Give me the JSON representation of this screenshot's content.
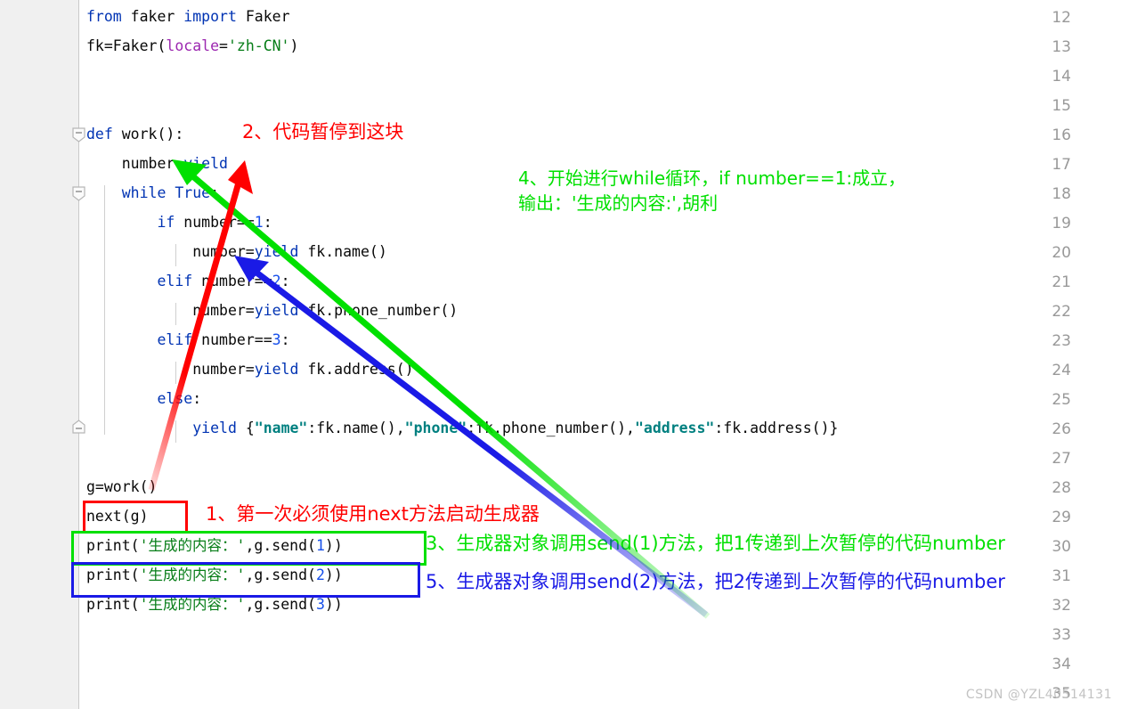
{
  "editor": {
    "line_numbers": [
      12,
      13,
      14,
      15,
      16,
      17,
      18,
      19,
      20,
      21,
      22,
      23,
      24,
      25,
      26,
      27,
      28,
      29,
      30,
      31,
      32,
      33,
      34,
      35
    ],
    "first_line": 12,
    "last_line": 35,
    "watermark": "CSDN @YZL40514131",
    "colors": {
      "gutter_bg": "#f0f0f0",
      "gutter_text": "#999999",
      "code_bg": "#ffffff",
      "keyword": "#0033b3",
      "number": "#1750eb",
      "string": "#067d17",
      "dict_key": "#008080",
      "named_arg": "#9c27b0",
      "annotation_red": "#ff0000",
      "annotation_green": "#00e000",
      "annotation_blue": "#1a1ae6"
    },
    "code_lines": [
      {
        "n": 12,
        "text": "from faker import Faker"
      },
      {
        "n": 13,
        "text": "fk=Faker(locale='zh-CN')"
      },
      {
        "n": 14,
        "text": ""
      },
      {
        "n": 15,
        "text": ""
      },
      {
        "n": 16,
        "text": "def work():"
      },
      {
        "n": 17,
        "text": "    number=yield"
      },
      {
        "n": 18,
        "text": "    while True:"
      },
      {
        "n": 19,
        "text": "        if number==1:"
      },
      {
        "n": 20,
        "text": "            number=yield fk.name()"
      },
      {
        "n": 21,
        "text": "        elif number==2:"
      },
      {
        "n": 22,
        "text": "            number=yield fk.phone_number()"
      },
      {
        "n": 23,
        "text": "        elif number==3:"
      },
      {
        "n": 24,
        "text": "            number=yield fk.address()"
      },
      {
        "n": 25,
        "text": "        else:"
      },
      {
        "n": 26,
        "text": "            yield {\"name\":fk.name(),\"phone\":fk.phone_number(),\"address\":fk.address()}"
      },
      {
        "n": 27,
        "text": ""
      },
      {
        "n": 28,
        "text": "g=work()"
      },
      {
        "n": 29,
        "text": "next(g)"
      },
      {
        "n": 30,
        "text": "print('生成的内容：',g.send(1))"
      },
      {
        "n": 31,
        "text": "print('生成的内容：',g.send(2))"
      },
      {
        "n": 32,
        "text": "print('生成的内容：',g.send(3))"
      },
      {
        "n": 33,
        "text": ""
      },
      {
        "n": 34,
        "text": ""
      },
      {
        "n": 35,
        "text": ""
      }
    ],
    "tokens": {
      "l12": {
        "kw1": "from",
        "mod": " faker ",
        "kw2": "import",
        "name": " Faker"
      },
      "l13": {
        "pre": "fk=Faker(",
        "arg": "locale",
        "eq": "=",
        "str": "'zh-CN'",
        "post": ")"
      },
      "l16": {
        "kw": "def",
        "rest": " work():"
      },
      "l17": {
        "pre": "    number=",
        "kw": "yield"
      },
      "l18": {
        "pre": "    ",
        "kw": "while",
        "kw2": " True",
        "post": ":"
      },
      "l19": {
        "pre": "        ",
        "kw": "if",
        "mid": " number==",
        "num": "1",
        "post": ":"
      },
      "l20": {
        "pre": "            number=",
        "kw": "yield",
        "post": " fk.name()"
      },
      "l21": {
        "pre": "        ",
        "kw": "elif",
        "mid": " number==",
        "num": "2",
        "post": ":"
      },
      "l22": {
        "pre": "            number=",
        "kw": "yield",
        "post": " fk.phone_number()"
      },
      "l23": {
        "pre": "        ",
        "kw": "elif",
        "mid": " number==",
        "num": "3",
        "post": ":"
      },
      "l24": {
        "pre": "            number=",
        "kw": "yield",
        "post": " fk.address()"
      },
      "l25": {
        "pre": "        ",
        "kw": "else",
        "post": ":"
      },
      "l26": {
        "pre": "            ",
        "kw": "yield",
        "brace1": " {",
        "k1": "\"name\"",
        "v1": ":fk.name(),",
        "k2": "\"phone\"",
        "v2": ":fk.phone_number(),",
        "k3": "\"address\"",
        "v3": ":fk.address()}"
      },
      "l28": {
        "text": "g=work()"
      },
      "l29": {
        "text": "next(g)"
      },
      "l30": {
        "pre": "print(",
        "str": "'生成的内容：'",
        "mid": ",g.send(",
        "num": "1",
        "post": "))"
      },
      "l31": {
        "pre": "print(",
        "str": "'生成的内容：'",
        "mid": ",g.send(",
        "num": "2",
        "post": "))"
      },
      "l32": {
        "pre": "print(",
        "str": "'生成的内容：'",
        "mid": ",g.send(",
        "num": "3",
        "post": "))"
      }
    }
  },
  "annotations": [
    {
      "id": "a2",
      "color": "red",
      "text": "2、代码暂停到这块"
    },
    {
      "id": "a4l1",
      "color": "green",
      "text": "4、开始进行while循环，if number==1:成立，"
    },
    {
      "id": "a4l2",
      "color": "green",
      "text": "输出：'生成的内容:',胡利"
    },
    {
      "id": "a1",
      "color": "red",
      "text": "1、第一次必须使用next方法启动生成器"
    },
    {
      "id": "a3",
      "color": "green",
      "text": "3、生成器对象调用send(1)方法，把1传递到上次暂停的代码number"
    },
    {
      "id": "a5",
      "color": "blue",
      "text": "5、生成器对象调用send(2)方法，把2传递到上次暂停的代码number"
    }
  ],
  "highlight_boxes": [
    {
      "id": "box-next",
      "color": "#ff0000",
      "target_line": 29
    },
    {
      "id": "box-send1",
      "color": "#00e000",
      "target_line": 30
    },
    {
      "id": "box-send2",
      "color": "#1a1ae6",
      "target_line": 31
    }
  ],
  "arrows": [
    {
      "id": "arrow-green",
      "color": "#00e000",
      "from": "print send(1) line",
      "to": "number=yield (line 17)"
    },
    {
      "id": "arrow-red",
      "color": "#ff0000",
      "from": "next(g) (line 29)",
      "to": "number=yield (line 17)"
    },
    {
      "id": "arrow-blue",
      "color": "#1a1ae6",
      "from": "print send(2) line",
      "to": "number=yield fk.name() (line 20)"
    }
  ]
}
